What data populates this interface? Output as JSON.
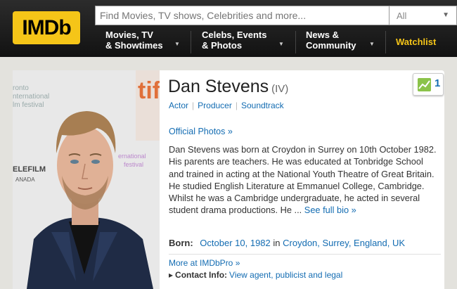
{
  "header": {
    "logo_text": "IMDb",
    "search_placeholder": "Find Movies, TV shows, Celebrities and more...",
    "search_category": "All",
    "nav": {
      "movies_line1": "Movies, TV",
      "movies_line2": "& Showtimes",
      "celebs_line1": "Celebs, Events",
      "celebs_line2": "& Photos",
      "news_line1": "News &",
      "news_line2": "Community",
      "watchlist": "Watchlist"
    }
  },
  "profile": {
    "name": "Dan Stevens",
    "name_suffix": "(IV)",
    "roles": [
      "Actor",
      "Producer",
      "Soundtrack"
    ],
    "star_meter_value": "1",
    "official_photos": "Official Photos »",
    "bio": "Dan Stevens was born at Croydon in Surrey on 10th October 1982. His parents are teachers. He was educated at Tonbridge School and trained in acting at the National Youth Theatre of Great Britain. He studied English Literature at Emmanuel College, Cambridge. Whilst he was a Cambridge undergraduate, he acted in several student drama productions. He ...",
    "bio_more": "See full bio »",
    "born_label": "Born:",
    "born_date": "October 10, 1982",
    "born_in": "in",
    "born_place": "Croydon, Surrey, England, UK",
    "imdbpro": "More at IMDbPro »",
    "contact_label": "Contact Info:",
    "contact_link": "View agent, publicist and legal",
    "photo_backdrop_text": {
      "line1": "ronto",
      "line2": "nternational",
      "line3": "lm festival",
      "line4": "ELEFILM",
      "line5": "ANADA"
    }
  },
  "colors": {
    "brand_yellow": "#f5c518",
    "link_blue": "#136cb2",
    "header_dark": "#1b1b1b"
  }
}
